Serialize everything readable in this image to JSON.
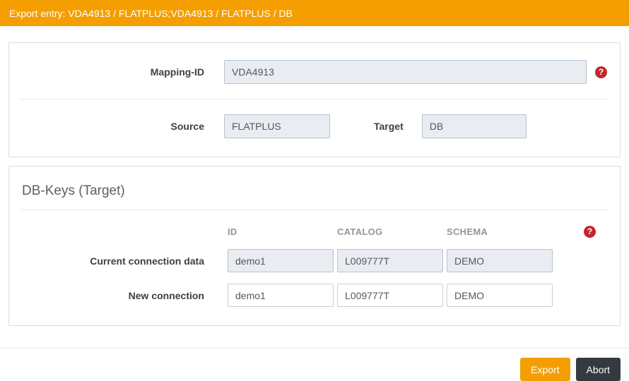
{
  "header": {
    "title": "Export entry: VDA4913 / FLATPLUS;VDA4913 / FLATPLUS / DB"
  },
  "mapping_panel": {
    "mapping_id_label": "Mapping-ID",
    "mapping_id_value": "VDA4913",
    "source_label": "Source",
    "source_value": "FLATPLUS",
    "target_label": "Target",
    "target_value": "DB"
  },
  "db_keys_panel": {
    "title": "DB-Keys (Target)",
    "columns": [
      "ID",
      "CATALOG",
      "SCHEMA"
    ],
    "rows": [
      {
        "label": "Current connection data",
        "values": [
          "demo1",
          "L009777T",
          "DEMO"
        ],
        "readonly": true
      },
      {
        "label": "New connection",
        "values": [
          "demo1",
          "L009777T",
          "DEMO"
        ],
        "readonly": false
      }
    ]
  },
  "footer": {
    "export_label": "Export",
    "abort_label": "Abort"
  },
  "icons": {
    "help_glyph": "?"
  },
  "colors": {
    "accent_orange": "#f59e00",
    "help_icon_red": "#c1272d",
    "abort_dark": "#343a40",
    "disabled_input_bg": "#e9edf2"
  }
}
